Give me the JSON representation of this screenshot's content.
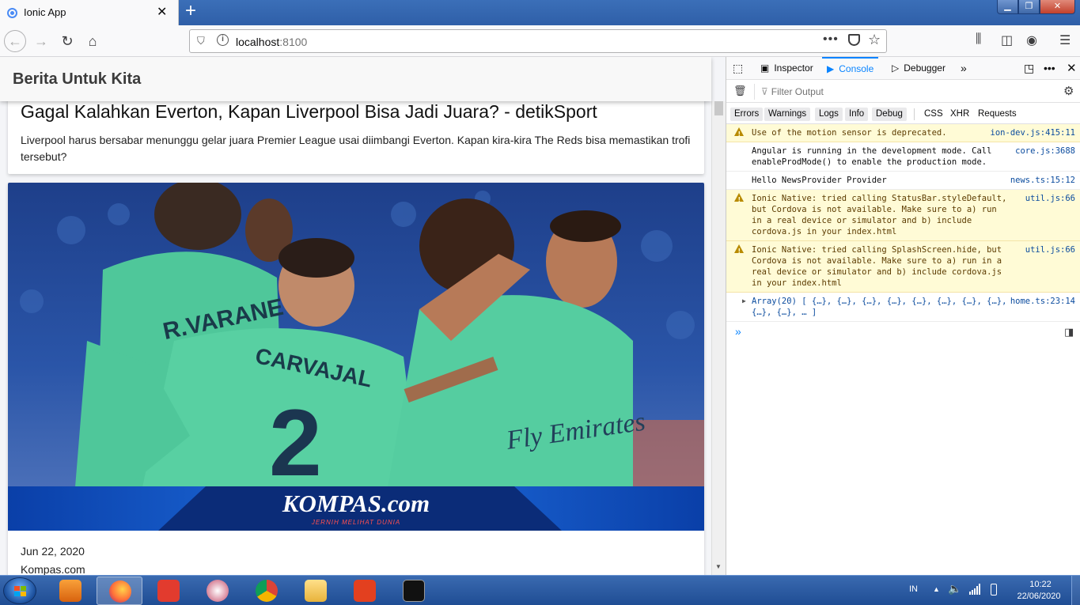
{
  "browser": {
    "tab_title": "Ionic App",
    "tab_close": "✕",
    "new_tab": "+",
    "url_host": "localhost",
    "url_port": ":8100",
    "url_more": "•••"
  },
  "app": {
    "title": "Berita Untuk Kita",
    "articles": [
      {
        "title": "Gagal Kalahkan Everton, Kapan Liverpool Bisa Jadi Juara? - detikSport",
        "description": "Liverpool harus bersabar menunggu gelar juara Premier League usai diimbangi Everton. Kapan kira-kira The Reds bisa memastikan trofi tersebut?"
      },
      {
        "image_banner": "KOMPAS.com",
        "image_tagline": "JERNIH MELIHAT DUNIA",
        "jersey_name_1": "R.VARANE",
        "jersey_name_2": "CARVAJAL",
        "jersey_number": "2",
        "sponsor": "Fly Emirates",
        "date": "Jun 22, 2020",
        "source": "Kompas.com"
      }
    ]
  },
  "devtools": {
    "tabs": {
      "inspector": "Inspector",
      "console": "Console",
      "debugger": "Debugger"
    },
    "filter_placeholder": "Filter Output",
    "levels": [
      "Errors",
      "Warnings",
      "Logs",
      "Info",
      "Debug"
    ],
    "extra_filters": [
      "CSS",
      "XHR",
      "Requests"
    ],
    "messages": [
      {
        "type": "warning",
        "text": "Use of the motion sensor is deprecated.",
        "source": "ion-dev.js:415:11"
      },
      {
        "type": "log",
        "text": "Angular is running in the development mode. Call enableProdMode() to enable the production mode.",
        "source": "core.js:3688"
      },
      {
        "type": "log",
        "text": "Hello NewsProvider Provider",
        "source": "news.ts:15:12"
      },
      {
        "type": "warning",
        "text": "Ionic Native: tried calling StatusBar.styleDefault, but Cordova is not available. Make sure to a) run in a real device or simulator and b) include cordova.js in your index.html",
        "source": "util.js:66"
      },
      {
        "type": "warning",
        "text": "Ionic Native: tried calling SplashScreen.hide, but Cordova is not available. Make sure to a) run in a real device or simulator and b) include cordova.js in your index.html",
        "source": "util.js:66"
      },
      {
        "type": "array",
        "label": "Array(20)",
        "text": "[ {…}, {…}, {…}, {…}, {…}, {…}, {…}, {…}, {…}, {…}, … ]",
        "source": "home.ts:23:14"
      }
    ],
    "prompt": "»"
  },
  "taskbar": {
    "language": "IN",
    "time": "10:22",
    "date": "22/06/2020"
  },
  "colors": {
    "accent": "#0a84ff",
    "warning_bg": "#fffbd6",
    "taskbar": "#2a5aa3",
    "jersey": "#4fc79a"
  }
}
